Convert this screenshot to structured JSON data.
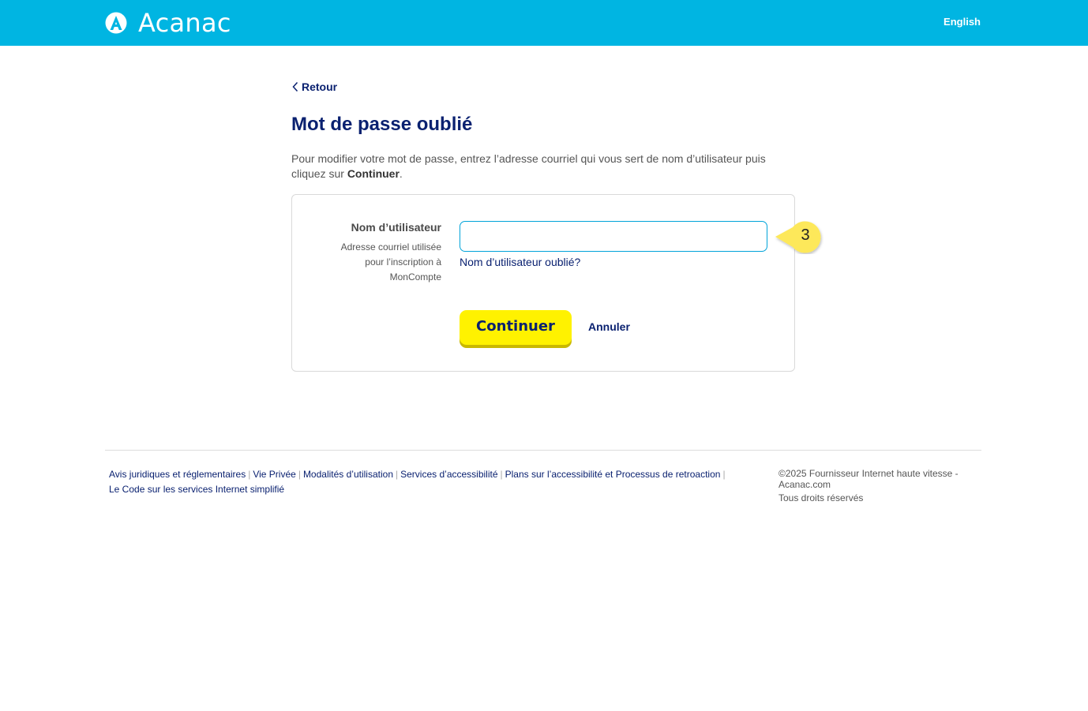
{
  "header": {
    "brand": "Acanac",
    "language_link": "English",
    "bar_color": "#00b5e2"
  },
  "nav": {
    "back_label": "Retour"
  },
  "page": {
    "title": "Mot de passe oublié",
    "intro_prefix": "Pour modifier votre mot de passe, entrez l’adresse courriel qui vous sert de nom d’utilisateur puis cliquez sur ",
    "intro_bold": "Continuer",
    "intro_suffix": "."
  },
  "form": {
    "username_label": "Nom d’utilisateur",
    "username_help": "Adresse courriel utilisée pour l’inscription à MonCompte",
    "username_value": "",
    "forgot_username_link": "Nom d’utilisateur oublié?",
    "continue_button": "Continuer",
    "cancel_link": "Annuler"
  },
  "annotation": {
    "step_number": "3",
    "color": "#fde85a"
  },
  "footer": {
    "links": [
      "Avis juridiques et réglementaires",
      "Vie Privée",
      "Modalités d’utilisation",
      "Services d’accessibilité",
      "Plans sur l’accessibilité et Processus de retroaction",
      "Le Code sur les services Internet simplifié"
    ],
    "copyright": "©2025 Fournisseur Internet haute vitesse - Acanac.com",
    "rights": "Tous droits réservés"
  },
  "colors": {
    "primary_navy": "#0a2170",
    "button_yellow": "#fff200",
    "input_border": "#00a3d9"
  }
}
